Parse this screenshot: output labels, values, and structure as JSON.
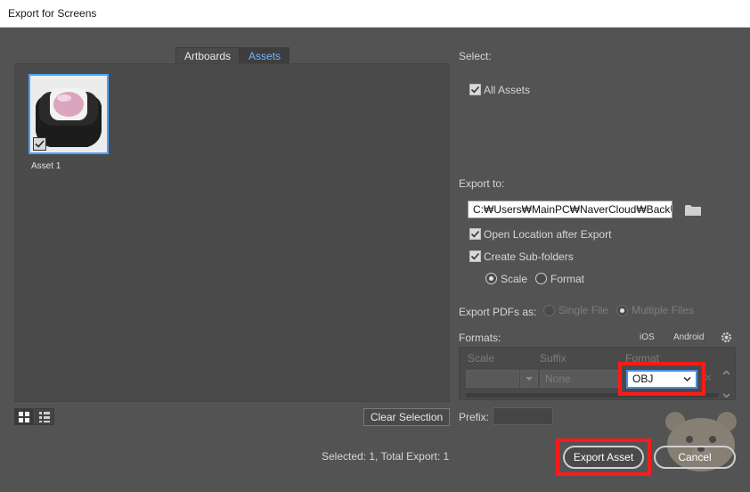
{
  "window": {
    "title": "Export for Screens"
  },
  "tabs": [
    {
      "label": "Artboards",
      "active": false
    },
    {
      "label": "Assets",
      "active": true
    }
  ],
  "assets": [
    {
      "label": "Asset 1",
      "checked": true
    }
  ],
  "left_footer": {
    "clear_selection": "Clear Selection"
  },
  "select_section": {
    "heading": "Select:",
    "all_assets": {
      "label": "All Assets",
      "checked": true
    }
  },
  "export_to": {
    "heading": "Export to:",
    "path": "C:₩Users₩MainPC₩NaverCloud₩BackUp",
    "open_location": {
      "label": "Open Location after Export",
      "checked": true
    },
    "create_subfolders": {
      "label": "Create Sub-folders",
      "checked": true
    },
    "scale_option": {
      "label": "Scale",
      "selected": true
    },
    "format_option": {
      "label": "Format",
      "selected": false
    }
  },
  "export_pdfs": {
    "heading": "Export PDFs as:",
    "single_file": "Single File",
    "multiple_files": "Multiple Files"
  },
  "formats": {
    "heading": "Formats:",
    "ios": "iOS",
    "android": "Android",
    "columns": {
      "scale": "Scale",
      "suffix": "Suffix",
      "format": "Format"
    },
    "row": {
      "suffix_placeholder": "None",
      "format_value": "OBJ"
    }
  },
  "prefix": {
    "label": "Prefix:"
  },
  "status": "Selected: 1, Total Export: 1",
  "buttons": {
    "export_asset": "Export Asset",
    "cancel": "Cancel"
  },
  "colors": {
    "accent": "#4aa3ff",
    "highlight_box": "#ff1a1a",
    "panel_bg": "#535353"
  }
}
